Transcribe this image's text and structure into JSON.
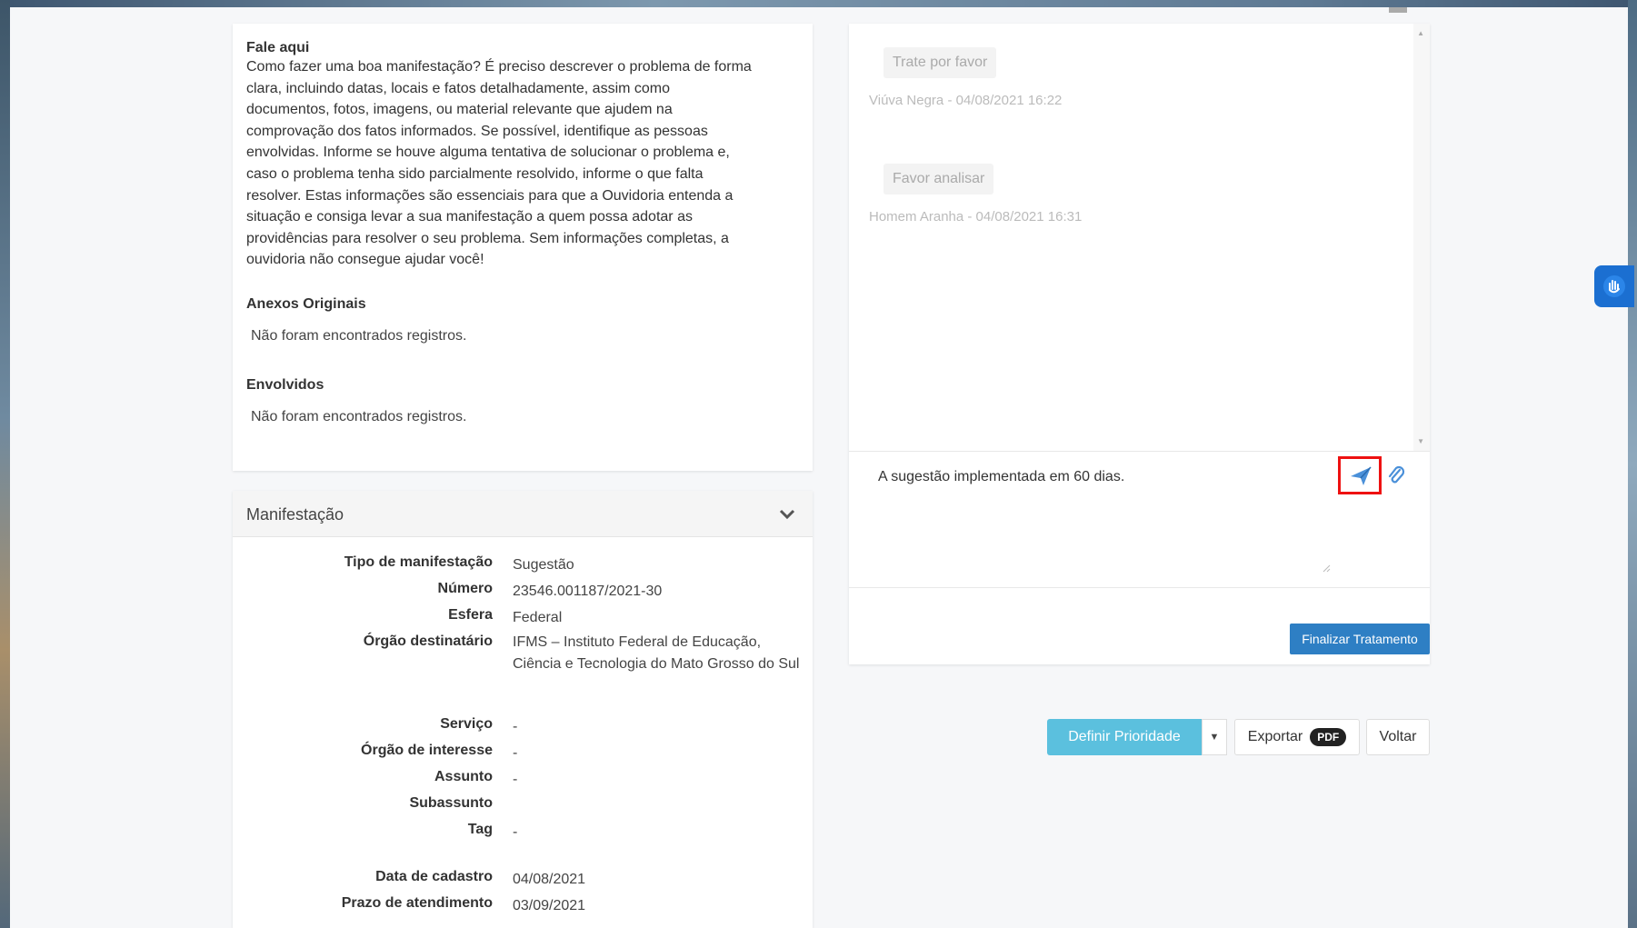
{
  "description": {
    "heading": "Fale aqui",
    "lines": [
      "Como fazer uma boa manifestação? É preciso descrever o problema de forma",
      "clara, incluindo datas, locais e fatos detalhadamente, assim como",
      "documentos, fotos, imagens, ou material relevante que ajudem na",
      "comprovação dos fatos informados. Se possível, identifique as pessoas",
      "envolvidas. Informe se houve alguma tentativa de solucionar o problema e,",
      "caso o problema tenha sido parcialmente resolvido, informe o que falta",
      "resolver. Estas informações são essenciais para que a Ouvidoria entenda a",
      "situação e consiga levar a sua manifestação a quem possa adotar as",
      "providências para resolver o seu problema. Sem informações completas, a",
      "ouvidoria não consegue ajudar você!"
    ],
    "anexos_title": "Anexos Originais",
    "anexos_empty": "Não foram encontrados registros.",
    "envolvidos_title": "Envolvidos",
    "envolvidos_empty": "Não foram encontrados registros."
  },
  "manifestacao": {
    "title": "Manifestação",
    "rows": [
      {
        "label": "Tipo de manifestação",
        "value": "Sugestão"
      },
      {
        "label": "Número",
        "value": "23546.001187/2021-30"
      },
      {
        "label": "Esfera",
        "value": "Federal"
      },
      {
        "label": "Órgão destinatário",
        "value": "IFMS – Instituto Federal de Educação, Ciência e Tecnologia do Mato Grosso do Sul"
      },
      {
        "label": "Serviço",
        "value": "-"
      },
      {
        "label": "Órgão de interesse",
        "value": "-"
      },
      {
        "label": "Assunto",
        "value": "-"
      },
      {
        "label": "Subassunto",
        "value": ""
      },
      {
        "label": "Tag",
        "value": "-"
      },
      {
        "label": "Data de cadastro",
        "value": "04/08/2021"
      },
      {
        "label": "Prazo de atendimento",
        "value": "03/09/2021"
      }
    ]
  },
  "chat": {
    "messages": [
      {
        "text": "Trate por favor",
        "meta": "Viúva Negra - 04/08/2021 16:22"
      },
      {
        "text": "Favor analisar",
        "meta": "Homem Aranha - 04/08/2021 16:31"
      }
    ],
    "reply_value": "A sugestão implementada em 60 dias.",
    "finalize_label": "Finalizar Tratamento"
  },
  "toolbar": {
    "prioridade_label": "Definir Prioridade",
    "exportar_label": "Exportar",
    "pdf_badge": "PDF",
    "voltar_label": "Voltar"
  },
  "icons": {
    "send": "send-icon",
    "attach": "paperclip-icon",
    "chevron": "chevron-down-icon",
    "accessibility": "vlibras-hand-icon"
  },
  "colors": {
    "primary": "#2e7fc4",
    "info": "#5bc0de",
    "highlight_border": "#ee1111"
  }
}
